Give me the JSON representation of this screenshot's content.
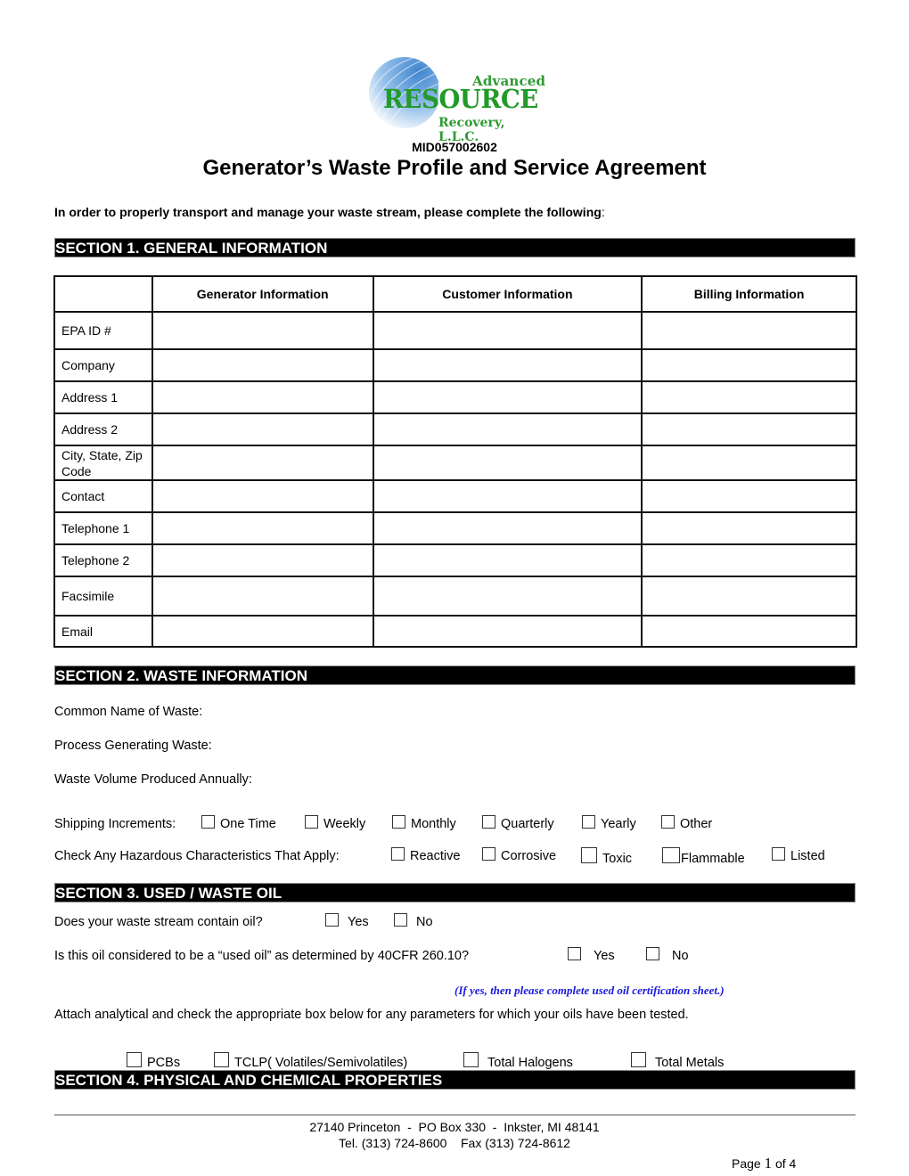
{
  "logo": {
    "line1": "Advanced",
    "line2": "RESOURCE",
    "line3": "Recovery, L.L.C.",
    "color": "#239a2b",
    "swirl_color": "#4a8fd6"
  },
  "epa_number": "MID057002602",
  "title": "Generator’s Waste Profile and Service Agreement",
  "intro": "In order to properly transport and manage your waste stream, please complete the following",
  "intro_colon": ":",
  "section1": {
    "heading": "SECTION 1. GENERAL INFORMATION",
    "columns": [
      "",
      "Generator Information",
      "Customer Information",
      "Billing Information"
    ],
    "rows": [
      {
        "label": "EPA ID #",
        "values": [
          "",
          "",
          ""
        ]
      },
      {
        "label": "Company",
        "values": [
          "",
          "",
          ""
        ]
      },
      {
        "label": "Address 1",
        "values": [
          "",
          "",
          ""
        ]
      },
      {
        "label": "Address 2",
        "values": [
          "",
          "",
          ""
        ]
      },
      {
        "label": "City, State, Zip Code",
        "values": [
          "",
          "",
          ""
        ]
      },
      {
        "label": "Contact",
        "values": [
          "",
          "",
          ""
        ]
      },
      {
        "label": "Telephone 1",
        "values": [
          "",
          "",
          ""
        ]
      },
      {
        "label": "Telephone 2",
        "values": [
          "",
          "",
          ""
        ]
      },
      {
        "label": "Facsimile",
        "values": [
          "",
          "",
          ""
        ]
      },
      {
        "label": "Email",
        "values": [
          "",
          "",
          ""
        ]
      }
    ]
  },
  "section2": {
    "heading": "SECTION 2. WASTE INFORMATION",
    "common_name_label": "Common Name of Waste:",
    "common_name_value": "",
    "process_label": "Process Generating Waste:",
    "process_value": "",
    "volume_label": "Waste Volume Produced Annually:",
    "volume_value": "",
    "shipping_label": "Shipping Increments:",
    "shipping_options": [
      {
        "label": "One Time",
        "checked": false
      },
      {
        "label": "Weekly",
        "checked": false
      },
      {
        "label": "Monthly",
        "checked": false
      },
      {
        "label": "Quarterly",
        "checked": false
      },
      {
        "label": "Yearly",
        "checked": false
      },
      {
        "label": "Other",
        "checked": false
      }
    ],
    "hazard_label": "Check Any Hazardous Characteristics That Apply:",
    "hazard_options": [
      {
        "label": "Reactive",
        "checked": false
      },
      {
        "label": "Corrosive",
        "checked": false
      },
      {
        "label": "Toxic",
        "checked": false
      },
      {
        "label": "Flammable",
        "checked": false
      },
      {
        "label": "Listed",
        "checked": false
      }
    ]
  },
  "section3": {
    "heading": "SECTION 3. USED / WASTE OIL",
    "q1": "Does your waste stream contain oil?",
    "q1_options": [
      {
        "label": "Yes",
        "checked": false
      },
      {
        "label": "No",
        "checked": false
      }
    ],
    "q2": "Is this oil considered to be a “used oil” as determined by 40CFR 260.10?",
    "q2_options": [
      {
        "label": "Yes",
        "checked": false
      },
      {
        "label": "No",
        "checked": false
      }
    ],
    "note": "(If yes, then please complete used oil certification sheet.)",
    "note_color": "#1a1adc",
    "attach_text": "Attach analytical and check the appropriate box below for any parameters for which your oils have been tested.",
    "test_options": [
      {
        "label": "PCBs",
        "checked": false
      },
      {
        "label": "TCLP( Volatiles/Semivolatiles)",
        "checked": false
      },
      {
        "label": "Total Halogens",
        "checked": false
      },
      {
        "label": "Total Metals",
        "checked": false
      }
    ]
  },
  "section4": {
    "heading": "SECTION 4. PHYSICAL AND CHEMICAL PROPERTIES"
  },
  "footer": {
    "address": "27140 Princeton  -  PO Box 330  -  Inkster, MI 48141",
    "phones": "Tel. (313) 724-8600    Fax (313) 724-8612",
    "page_prefix": "Page ",
    "page_current": "1",
    "page_suffix": " of 4"
  }
}
